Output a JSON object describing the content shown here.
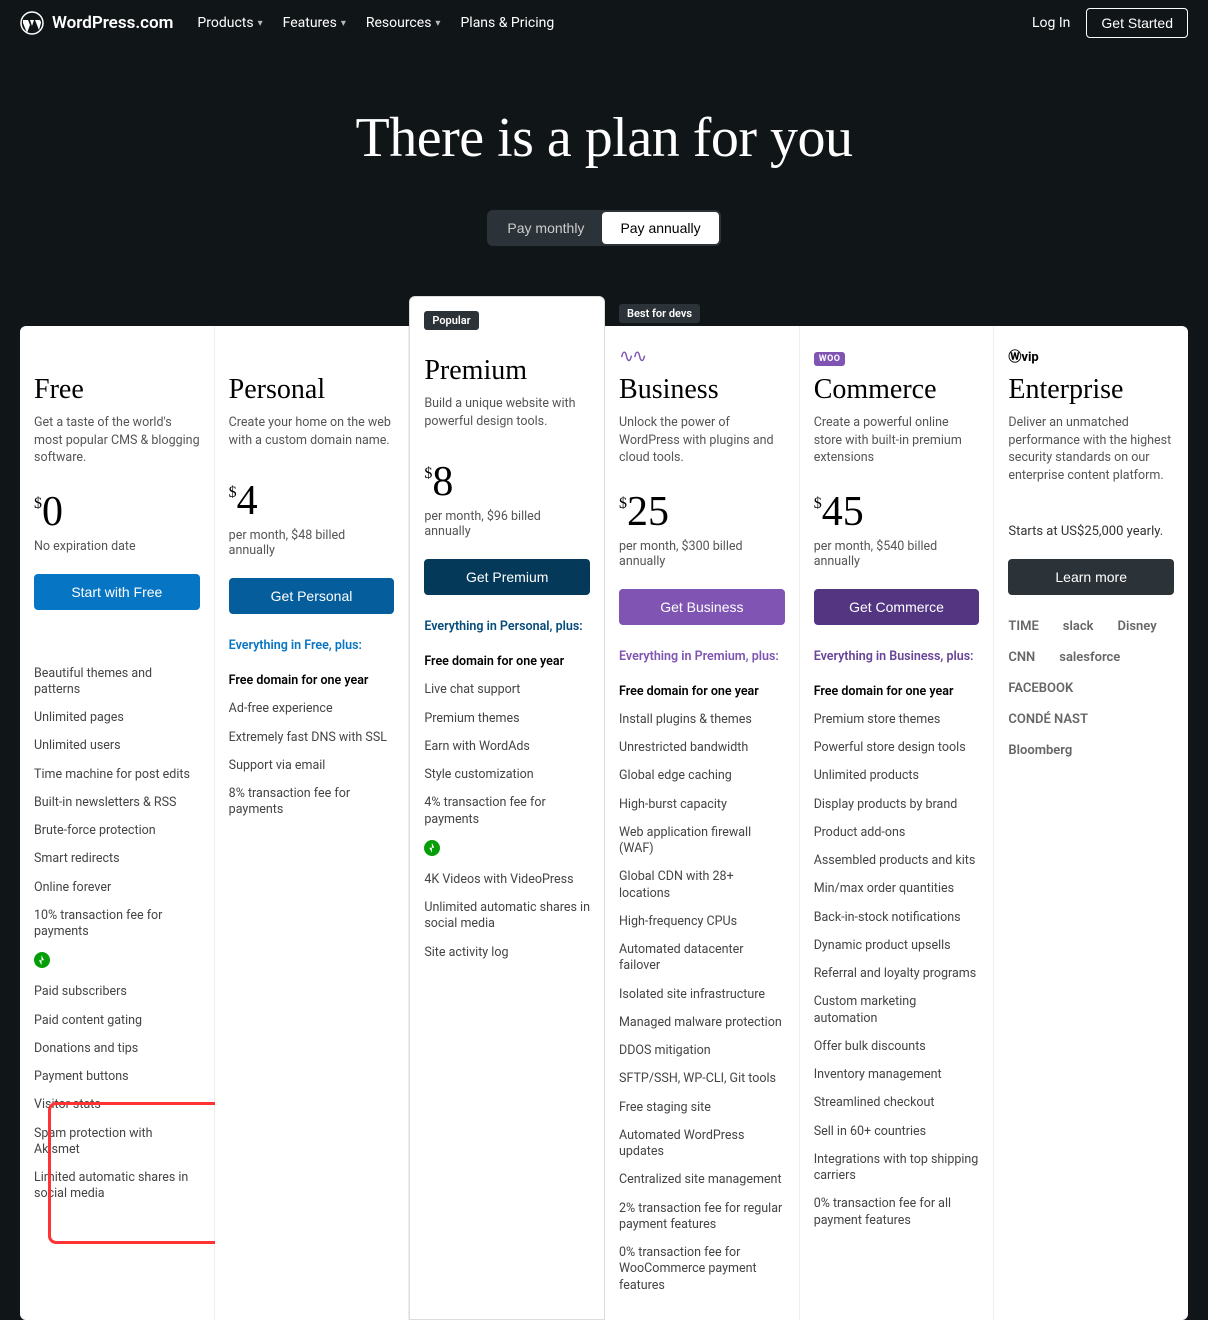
{
  "header": {
    "brand": "WordPress.com",
    "nav": [
      "Products",
      "Features",
      "Resources",
      "Plans & Pricing"
    ],
    "login": "Log In",
    "get_started": "Get Started"
  },
  "hero": {
    "title": "There is a plan for you",
    "toggle": {
      "monthly": "Pay monthly",
      "annually": "Pay annually"
    }
  },
  "plans": [
    {
      "name": "Free",
      "desc": "Get a taste of the world's most popular CMS & blogging software.",
      "currency": "$",
      "price": "0",
      "note": "No expiration date",
      "cta": "Start with Free",
      "features": [
        "Beautiful themes and patterns",
        "Unlimited pages",
        "Unlimited users",
        "Time machine for post edits",
        "Built-in newsletters & RSS",
        "Brute-force protection",
        "Smart redirects",
        "Online forever",
        "10% transaction fee for payments"
      ],
      "jet_features": [
        "Paid subscribers",
        "Paid content gating",
        "Donations and tips",
        "Payment buttons",
        "Visitor stats",
        "Spam protection with Akismet",
        "Limited automatic shares in social media"
      ]
    },
    {
      "name": "Personal",
      "desc": "Create your home on the web with a custom domain name.",
      "currency": "$",
      "price": "4",
      "note": "per month, $48 billed annually",
      "cta": "Get Personal",
      "everything": "Everything in Free, plus:",
      "bold_feature": "Free domain for one year",
      "features": [
        "Ad-free experience",
        "Extremely fast DNS with SSL",
        "Support via email",
        "8% transaction fee for payments"
      ]
    },
    {
      "badge": "Popular",
      "name": "Premium",
      "desc": "Build a unique website with powerful design tools.",
      "currency": "$",
      "price": "8",
      "note": "per month, $96 billed annually",
      "cta": "Get Premium",
      "everything": "Everything in Personal, plus:",
      "bold_feature": "Free domain for one year",
      "features": [
        "Live chat support",
        "Premium themes",
        "Earn with WordAds",
        "Style customization",
        "4% transaction fee for payments"
      ],
      "jet_features": [
        "4K Videos with VideoPress",
        "Unlimited automatic shares in social media",
        "Site activity log"
      ]
    },
    {
      "badge": "Best for devs",
      "name": "Business",
      "desc": "Unlock the power of WordPress with plugins and cloud tools.",
      "currency": "$",
      "price": "25",
      "note": "per month, $300 billed annually",
      "cta": "Get Business",
      "everything": "Everything in Premium, plus:",
      "bold_feature": "Free domain for one year",
      "features": [
        "Install plugins & themes",
        "Unrestricted bandwidth",
        "Global edge caching",
        "High-burst capacity",
        "Web application firewall (WAF)",
        "Global CDN with 28+ locations",
        "High-frequency CPUs",
        "Automated datacenter failover",
        "Isolated site infrastructure",
        "Managed malware protection",
        "DDOS mitigation",
        "SFTP/SSH, WP-CLI, Git tools",
        "Free staging site",
        "Automated WordPress updates",
        "Centralized site management",
        "2% transaction fee for regular payment features",
        "0% transaction fee for WooCommerce payment features"
      ]
    },
    {
      "name": "Commerce",
      "desc": "Create a powerful online store with built-in premium extensions",
      "currency": "$",
      "price": "45",
      "note": "per month, $540 billed annually",
      "cta": "Get Commerce",
      "everything": "Everything in Business, plus:",
      "bold_feature": "Free domain for one year",
      "features": [
        "Premium store themes",
        "Powerful store design tools",
        "Unlimited products",
        "Display products by brand",
        "Product add-ons",
        "Assembled products and kits",
        "Min/max order quantities",
        "Back-in-stock notifications",
        "Dynamic product upsells",
        "Referral and loyalty programs",
        "Custom marketing automation",
        "Offer bulk discounts",
        "Inventory management",
        "Streamlined checkout",
        "Sell in 60+ countries",
        "Integrations with top shipping carriers",
        "0% transaction fee for all payment features"
      ]
    },
    {
      "name": "Enterprise",
      "desc": "Deliver an unmatched performance with the highest security standards on our enterprise content platform.",
      "start": "Starts at US$25,000 yearly.",
      "cta": "Learn more",
      "logos": [
        "TIME",
        "slack",
        "Disney",
        "CNN",
        "salesforce",
        "FACEBOOK",
        "CONDÉ NAST",
        "Bloomberg"
      ]
    }
  ]
}
